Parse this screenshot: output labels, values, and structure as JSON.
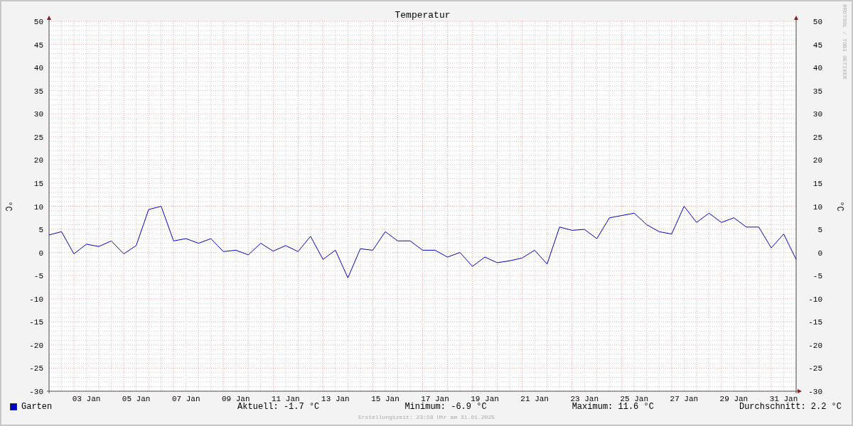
{
  "chart": {
    "chart_data": {
      "type": "line",
      "title": "Temperatur",
      "ylabel": "°C",
      "categories": [
        null,
        null,
        null,
        "03 Jan",
        null,
        null,
        null,
        "05 Jan",
        null,
        null,
        null,
        "07 Jan",
        null,
        null,
        null,
        "09 Jan",
        null,
        null,
        null,
        "11 Jan",
        null,
        null,
        null,
        "13 Jan",
        null,
        null,
        null,
        "15 Jan",
        null,
        null,
        null,
        "17 Jan",
        null,
        null,
        null,
        "19 Jan",
        null,
        null,
        null,
        "21 Jan",
        null,
        null,
        null,
        "23 Jan",
        null,
        null,
        null,
        "25 Jan",
        null,
        null,
        null,
        "27 Jan",
        null,
        null,
        null,
        "29 Jan",
        null,
        null,
        null,
        "31 Jan",
        null
      ],
      "series": [
        {
          "name": "Garten",
          "color": "#0000cc",
          "values": [
            3.8,
            4.5,
            -0.3,
            1.8,
            1.3,
            2.5,
            -0.3,
            1.5,
            9.3,
            10,
            2.5,
            3,
            2,
            3,
            0.2,
            0.5,
            -0.5,
            2,
            0.3,
            1.5,
            0.2,
            3.5,
            -1.5,
            0.5,
            -5.5,
            0.8,
            0.5,
            4.5,
            2.5,
            2.5,
            0.5,
            0.5,
            -1,
            0,
            -3,
            -1,
            -2.2,
            -1.8,
            -1.2,
            0.5,
            -2.5,
            5.5,
            4.8,
            5,
            3,
            7.5,
            8,
            8.5,
            6,
            4.5,
            4,
            10,
            6.5,
            8.5,
            6.5,
            7.5,
            5.5,
            5.5,
            1,
            4,
            -1.5
          ]
        }
      ],
      "ylim": [
        -30,
        50
      ],
      "grid": true,
      "yticks": [
        -30,
        -25,
        -20,
        -15,
        -10,
        -5,
        0,
        5,
        10,
        15,
        20,
        25,
        30,
        35,
        40,
        45,
        50
      ]
    },
    "right_axis": {
      "label": "°C",
      "ticks": [
        "50",
        "45",
        "40",
        "35",
        "30",
        "25",
        "20",
        "15",
        "10",
        "5",
        "0",
        "-5",
        "-10",
        "-15",
        "-20",
        "-25",
        "-30"
      ]
    },
    "credit": "RRDTOOL / TOBI OETIKER"
  },
  "legend": {
    "stats": [
      "Aktuell: -1.7 °C",
      "Minimum: -6.9 °C",
      "Maximum: 11.6 °C",
      "Durchschnitt: 2.2 °C"
    ]
  },
  "footer": "Erstellungszeit: 23:58 Uhr am 31.01.2025"
}
